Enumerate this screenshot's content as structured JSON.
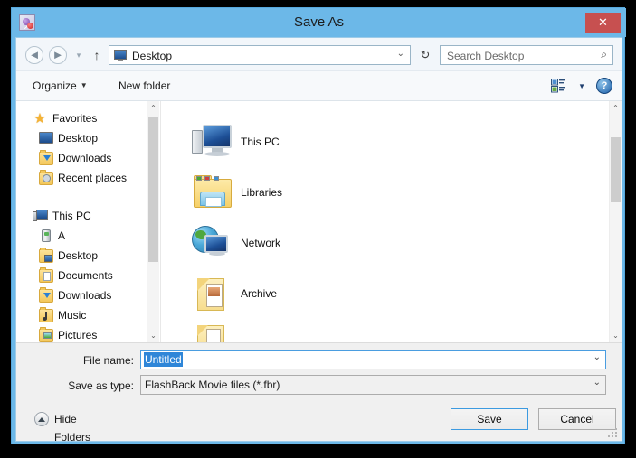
{
  "window": {
    "title": "Save As",
    "icon": "app-icon",
    "close_label": "✕"
  },
  "nav": {
    "back_icon": "◄",
    "forward_icon": "►",
    "recent_icon": "▾",
    "up_icon": "↑",
    "address_value": "Desktop",
    "address_icon": "monitor-icon",
    "address_caret": "⌄",
    "refresh_icon": "↻",
    "search_placeholder": "Search Desktop",
    "search_icon": "⌕"
  },
  "toolbar": {
    "organize_label": "Organize",
    "organize_caret": "▼",
    "new_folder_label": "New folder",
    "view_caret": "▼",
    "help_label": "?"
  },
  "sidebar": {
    "groups": [
      {
        "root": {
          "label": "Favorites",
          "icon": "star-icon"
        },
        "items": [
          {
            "label": "Desktop",
            "icon": "monitor-icon"
          },
          {
            "label": "Downloads",
            "icon": "folder-download-icon"
          },
          {
            "label": "Recent places",
            "icon": "folder-recent-icon"
          }
        ]
      },
      {
        "root": {
          "label": "This PC",
          "icon": "computer-icon"
        },
        "items": [
          {
            "label": "A",
            "icon": "drive-icon"
          },
          {
            "label": "Desktop",
            "icon": "folder-desktop-icon"
          },
          {
            "label": "Documents",
            "icon": "folder-documents-icon"
          },
          {
            "label": "Downloads",
            "icon": "folder-download-icon"
          },
          {
            "label": "Music",
            "icon": "folder-music-icon"
          },
          {
            "label": "Pictures",
            "icon": "folder-pictures-icon"
          }
        ]
      }
    ],
    "scroll_up_icon": "⌃",
    "scroll_down_icon": "⌄"
  },
  "file_list": {
    "items": [
      {
        "label": "",
        "icon": "partial-item-icon"
      },
      {
        "label": "This PC",
        "icon": "computer-icon"
      },
      {
        "label": "Libraries",
        "icon": "libraries-icon"
      },
      {
        "label": "Network",
        "icon": "network-icon"
      },
      {
        "label": "Archive",
        "icon": "folder-icon"
      },
      {
        "label": "",
        "icon": "partial-folder-icon"
      }
    ],
    "scroll_up_icon": "⌃",
    "scroll_down_icon": "⌄"
  },
  "form": {
    "filename_label": "File name:",
    "filename_value": "Untitled",
    "filename_caret": "⌄",
    "filetype_label": "Save as type:",
    "filetype_value": "FlashBack Movie files (*.fbr)",
    "filetype_caret": "⌄",
    "hide_folders_label": "Hide Folders",
    "save_label": "Save",
    "cancel_label": "Cancel"
  },
  "colors": {
    "title_bar": "#6cb8e8",
    "close_button": "#c75050",
    "selection": "#2f86d8",
    "focus_border": "#3c9ae0"
  }
}
